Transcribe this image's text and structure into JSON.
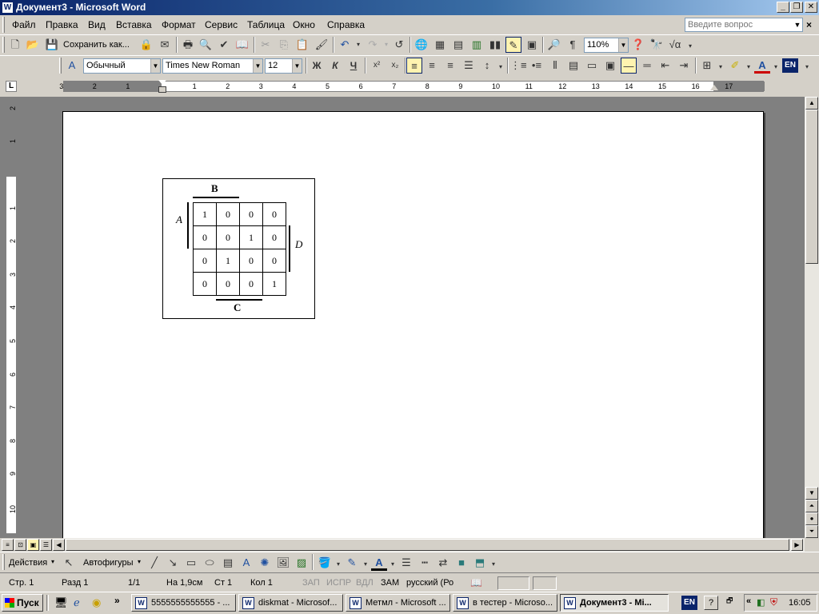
{
  "window": {
    "title": "Документ3 - Microsoft Word",
    "app_icon": "W"
  },
  "menu": {
    "items": [
      "Файл",
      "Правка",
      "Вид",
      "Вставка",
      "Формат",
      "Сервис",
      "Таблица",
      "Окно",
      "Справка"
    ]
  },
  "ask": {
    "placeholder": "Введите вопрос"
  },
  "toolbar1": {
    "save_label": "Сохранить как...",
    "zoom": "110%"
  },
  "toolbar2": {
    "style": "Обычный",
    "font": "Times New Roman",
    "size": "12",
    "bold": "Ж",
    "italic": "К",
    "underline": "Ч",
    "lang": "EN"
  },
  "ruler": {
    "h_marks": [
      "3",
      "2",
      "1",
      "1",
      "2",
      "3",
      "4",
      "5",
      "6",
      "7",
      "8",
      "9",
      "10",
      "11",
      "12",
      "13",
      "14",
      "15",
      "16",
      "17"
    ],
    "v_marks": [
      "2",
      "1",
      "1",
      "2",
      "3",
      "4",
      "5",
      "6",
      "7",
      "8",
      "9",
      "10"
    ]
  },
  "kmap": {
    "label_top": "B",
    "label_left": "A",
    "label_right": "D",
    "label_bottom": "C",
    "rows": [
      [
        "1",
        "0",
        "0",
        "0"
      ],
      [
        "0",
        "0",
        "1",
        "0"
      ],
      [
        "0",
        "1",
        "0",
        "0"
      ],
      [
        "0",
        "0",
        "0",
        "1"
      ]
    ]
  },
  "drawing": {
    "actions": "Действия",
    "autoshapes": "Автофигуры"
  },
  "status": {
    "page": "Стр.  1",
    "section": "Разд  1",
    "pages": "1/1",
    "at": "На 1,9см",
    "line": "Ст  1",
    "col": "Кол  1",
    "rec": "ЗАП",
    "trk": "ИСПР",
    "ext": "ВДЛ",
    "ovr": "ЗАМ",
    "lang": "русский (Ро"
  },
  "taskbar": {
    "start": "Пуск",
    "tasks": [
      "5555555555555 - ...",
      "diskmat - Microsof...",
      "Метмл - Microsoft ...",
      "в тестер - Microso...",
      "Документ3 - Mi..."
    ],
    "lang": "EN",
    "clock": "16:05"
  }
}
